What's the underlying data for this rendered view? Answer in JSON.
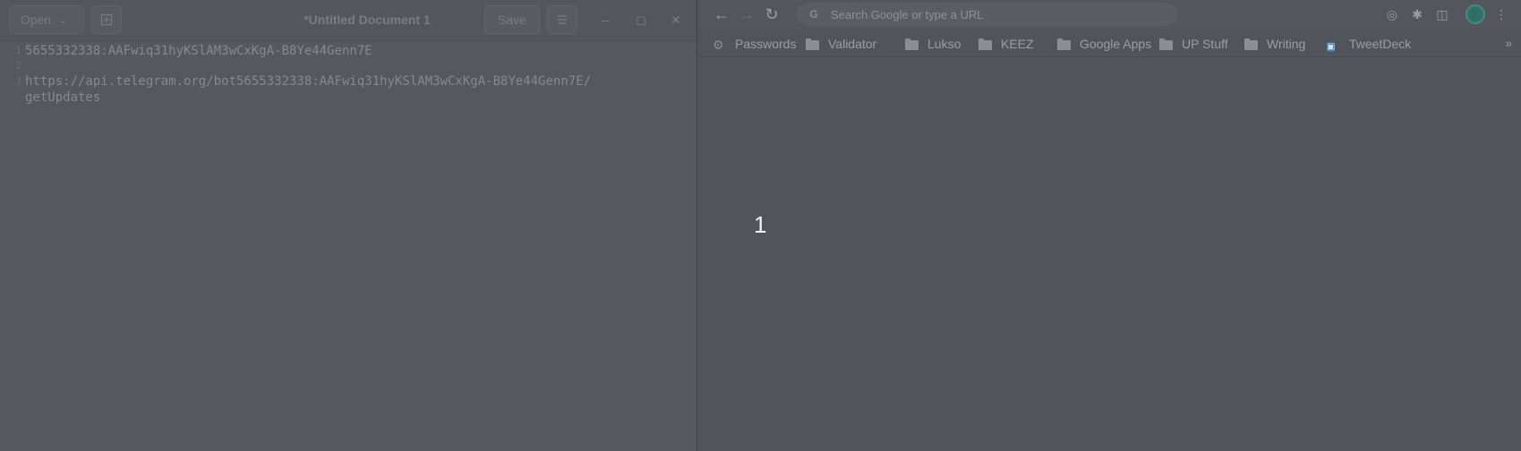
{
  "editor": {
    "open_label": "Open",
    "save_label": "Save",
    "title": "*Untitled Document 1",
    "lines": [
      {
        "number": "1",
        "text": "5655332338:AAFwiq31hyKSlAM3wCxKgA-B8Ye44Genn7E"
      },
      {
        "number": "2",
        "text": ""
      },
      {
        "number": "3",
        "text": "https://api.telegram.org/bot5655332338:AAFwiq31hyKSlAM3wCxKgA-B8Ye44Genn7E/"
      },
      {
        "number": "",
        "text": "getUpdates"
      }
    ]
  },
  "browser": {
    "omnibox": {
      "placeholder": "Search Google or type a URL"
    },
    "bookmarks": [
      {
        "label": "Passwords",
        "icon": "gear-icon"
      },
      {
        "label": "Validator",
        "icon": "folder-icon"
      },
      {
        "label": "Lukso",
        "icon": "folder-icon"
      },
      {
        "label": "KEEZ",
        "icon": "folder-icon"
      },
      {
        "label": "Google Apps",
        "icon": "folder-icon"
      },
      {
        "label": "UP Stuff",
        "icon": "folder-icon"
      },
      {
        "label": "Writing",
        "icon": "folder-icon"
      },
      {
        "label": "TweetDeck",
        "icon": "tweetdeck-icon"
      }
    ],
    "overflow_label": "»",
    "page_text": "1"
  },
  "colors": {
    "overlay_bg": "#4f5259",
    "page_number_text": "#f2f2f2",
    "profile_avatar": "#2f6f66"
  }
}
